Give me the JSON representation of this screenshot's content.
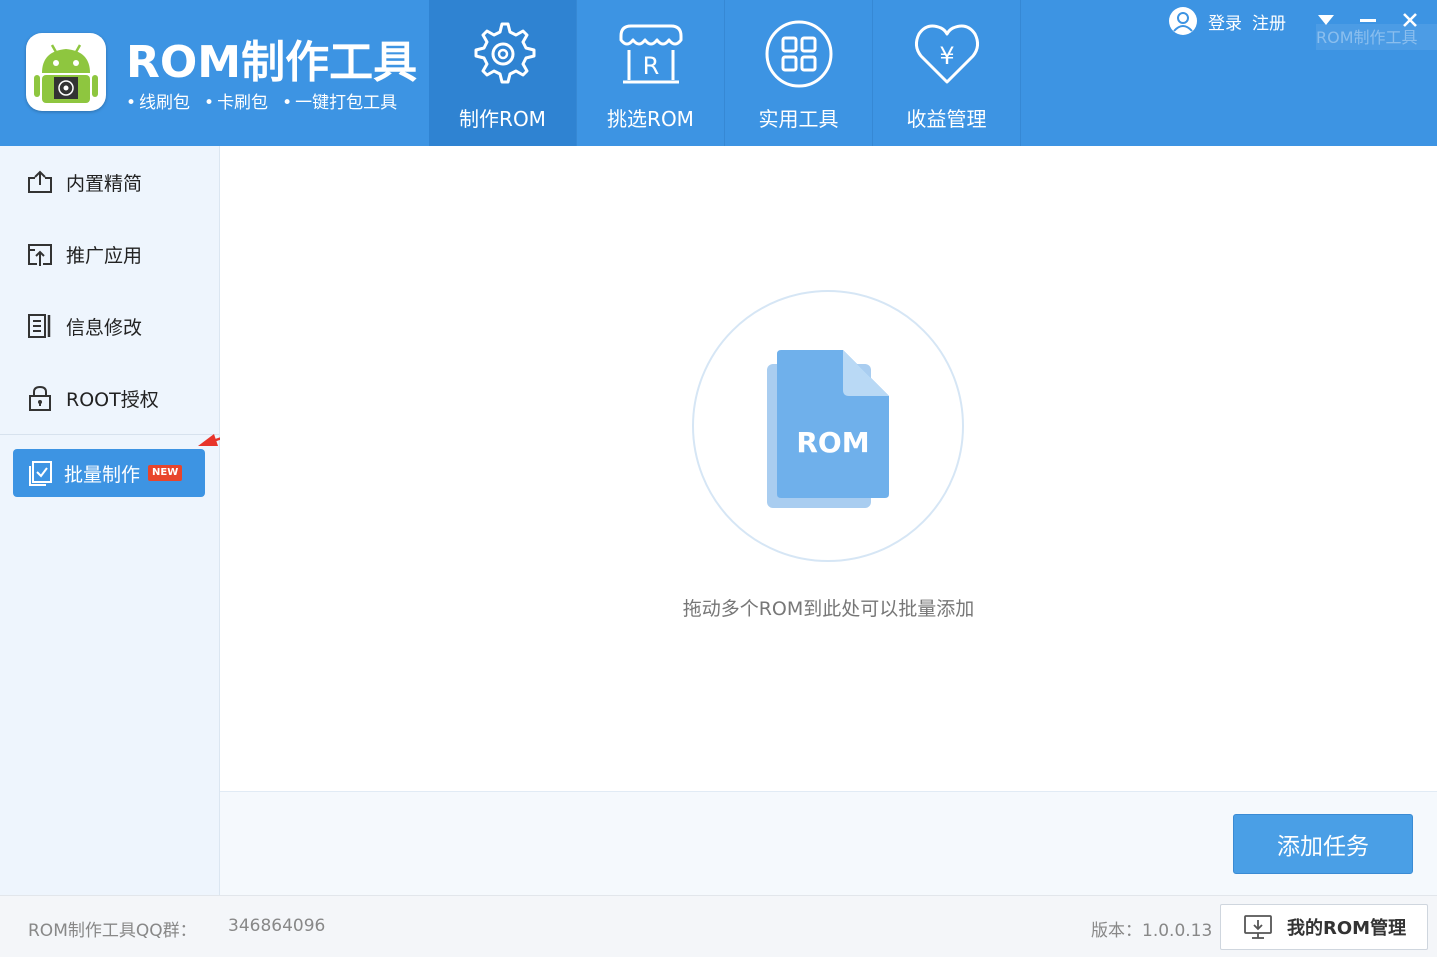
{
  "app": {
    "title": "ROM制作工具",
    "subtitle_items": [
      "线刷包",
      "卡刷包",
      "一键打包工具"
    ],
    "watermark": "ROM制作工具"
  },
  "nav": {
    "items": [
      {
        "label": "制作ROM",
        "icon": "gear-icon",
        "active": true
      },
      {
        "label": "挑选ROM",
        "icon": "store-icon",
        "active": false
      },
      {
        "label": "实用工具",
        "icon": "grid-icon",
        "active": false
      },
      {
        "label": "收益管理",
        "icon": "heart-yen-icon",
        "active": false
      }
    ]
  },
  "user": {
    "login": "登录",
    "register": "注册"
  },
  "sidebar": {
    "items": [
      {
        "label": "内置精简",
        "icon": "upload-box-icon"
      },
      {
        "label": "推广应用",
        "icon": "share-box-icon"
      },
      {
        "label": "信息修改",
        "icon": "document-edit-icon"
      },
      {
        "label": "ROOT授权",
        "icon": "lock-icon"
      }
    ],
    "active_item": {
      "label": "批量制作",
      "icon": "checklist-icon",
      "badge": "NEW"
    }
  },
  "main": {
    "drop_icon_text": "ROM",
    "drop_hint": "拖动多个ROM到此处可以批量添加",
    "add_task": "添加任务"
  },
  "footer": {
    "qq_label": "ROM制作工具QQ群：",
    "qq_number": "346864096",
    "version": "版本：1.0.0.13",
    "my_rom": "我的ROM管理"
  },
  "colors": {
    "brand": "#3d94e3",
    "nav_active": "#2f83d2",
    "sidebar_bg": "#eef5fd",
    "badge": "#e8452c",
    "annotation": "#e8342a"
  }
}
